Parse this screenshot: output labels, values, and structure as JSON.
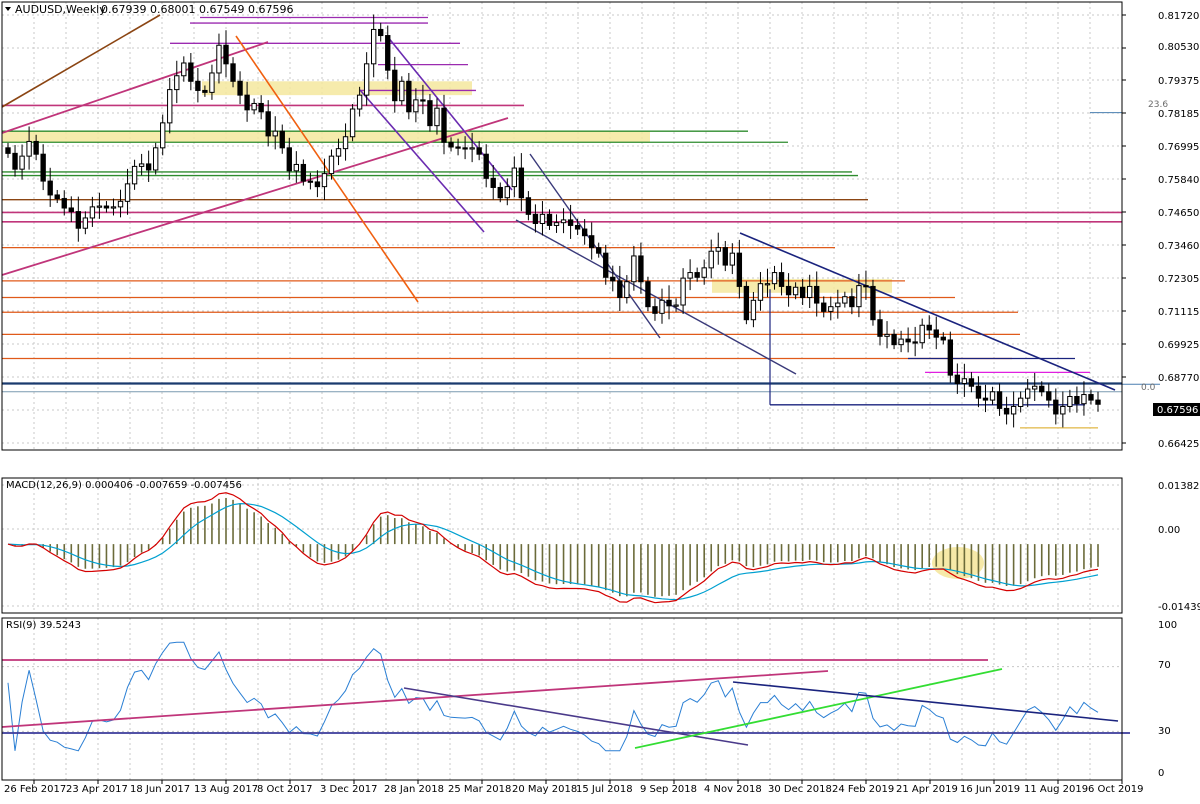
{
  "chart_data": {
    "type": "candlestick",
    "title": "AUDUSD,Weekly",
    "ohlc_header": "0.67939 0.68001 0.67549 0.67596",
    "current_price": "0.67596",
    "fib_labels": {
      "upper": "23.6",
      "lower": "0.0"
    },
    "price_axis": {
      "ticks": [
        "0.81720",
        "0.80530",
        "0.79375",
        "0.78185",
        "0.76995",
        "0.75840",
        "0.74650",
        "0.73460",
        "0.72305",
        "0.71115",
        "0.69925",
        "0.68770",
        "0.67596",
        "0.66425"
      ],
      "ylim": [
        0.6595,
        0.8211
      ]
    },
    "date_axis": [
      "26 Feb 2017",
      "23 Apr 2017",
      "18 Jun 2017",
      "13 Aug 2017",
      "8 Oct 2017",
      "3 Dec 2017",
      "28 Jan 2018",
      "25 Mar 2018",
      "20 May 2018",
      "15 Jul 2018",
      "9 Sep 2018",
      "4 Nov 2018",
      "30 Dec 2018",
      "24 Feb 2019",
      "21 Apr 2019",
      "16 Jun 2019",
      "11 Aug 2019",
      "6 Oct 2019"
    ],
    "weekly_closes": [
      0.7665,
      0.7608,
      0.7655,
      0.7708,
      0.7662,
      0.7565,
      0.7515,
      0.7502,
      0.7468,
      0.7455,
      0.7395,
      0.7432,
      0.7472,
      0.7475,
      0.7468,
      0.7472,
      0.7492,
      0.7555,
      0.7618,
      0.7627,
      0.7605,
      0.7685,
      0.7775,
      0.7895,
      0.7945,
      0.7991,
      0.7925,
      0.7892,
      0.7885,
      0.7955,
      0.8055,
      0.7988,
      0.7925,
      0.7875,
      0.7822,
      0.7845,
      0.7815,
      0.7728,
      0.7745,
      0.7685,
      0.7602,
      0.7625,
      0.7565,
      0.7562,
      0.7545,
      0.7592,
      0.7655,
      0.7682,
      0.7725,
      0.7825,
      0.7875,
      0.7988,
      0.8112,
      0.809,
      0.7965,
      0.7855,
      0.7925,
      0.7815,
      0.7858,
      0.7855,
      0.7765,
      0.7828,
      0.7705,
      0.7688,
      0.7685,
      0.7682,
      0.7685,
      0.7662,
      0.7575,
      0.7542,
      0.7505,
      0.7545,
      0.7612,
      0.7505,
      0.7445,
      0.7412,
      0.7445,
      0.7405,
      0.7415,
      0.7425,
      0.7405,
      0.7392,
      0.7368,
      0.7325,
      0.7305,
      0.7218,
      0.7205,
      0.7145,
      0.7202,
      0.7295,
      0.7202,
      0.7112,
      0.7088,
      0.7135,
      0.7115,
      0.7118,
      0.7215,
      0.7235,
      0.7218,
      0.7252,
      0.7312,
      0.7325,
      0.7262,
      0.7305,
      0.7185,
      0.7065,
      0.7135,
      0.7195,
      0.7195,
      0.7235,
      0.7185,
      0.7155,
      0.7182,
      0.7145,
      0.7185,
      0.7125,
      0.7095,
      0.7112,
      0.7125,
      0.7148,
      0.7112,
      0.7188,
      0.7185,
      0.7065,
      0.7005,
      0.7012,
      0.6975,
      0.6995,
      0.6985,
      0.6982,
      0.7045,
      0.7028,
      0.7002,
      0.6992,
      0.6865,
      0.6835,
      0.6852,
      0.6825,
      0.6782,
      0.6775,
      0.6805,
      0.6745,
      0.6725,
      0.6752,
      0.6782,
      0.6815,
      0.6825,
      0.6805,
      0.6775,
      0.6725,
      0.6752,
      0.6788,
      0.6762,
      0.6795,
      0.6775,
      0.676
    ],
    "horizontal_levels": [
      0.8155,
      0.8135,
      0.8062,
      0.7985,
      0.7892,
      0.7838,
      0.7745,
      0.7705,
      0.7598,
      0.7585,
      0.7498,
      0.7452,
      0.7418,
      0.7325,
      0.7205,
      0.7145,
      0.7092,
      0.7012,
      0.6925,
      0.6925,
      0.6875,
      0.6835,
      0.6832,
      0.6805,
      0.6758,
      0.6755,
      0.6675
    ],
    "macd": {
      "label": "MACD(12,26,9) 0.000406 -0.007659 -0.007456",
      "ticks": [
        "0.013821",
        "0.00",
        "-0.014396"
      ],
      "ylim": [
        -0.0148,
        0.0142
      ]
    },
    "rsi": {
      "label": "RSI(9) 39.5243",
      "ticks": [
        "100",
        "70",
        "30",
        "0"
      ],
      "ylim": [
        0,
        100
      ],
      "levels": [
        70,
        30
      ]
    },
    "colors": {
      "bull_body": "#ffffff",
      "bear_body": "#000000",
      "grid": "#c8c8c8",
      "signal_line": "#d40000",
      "macd_line": "#00a0d0",
      "histogram": "#6b6b3a",
      "rsi_line": "#2a7fd4",
      "zone": "#f5e79e"
    }
  }
}
